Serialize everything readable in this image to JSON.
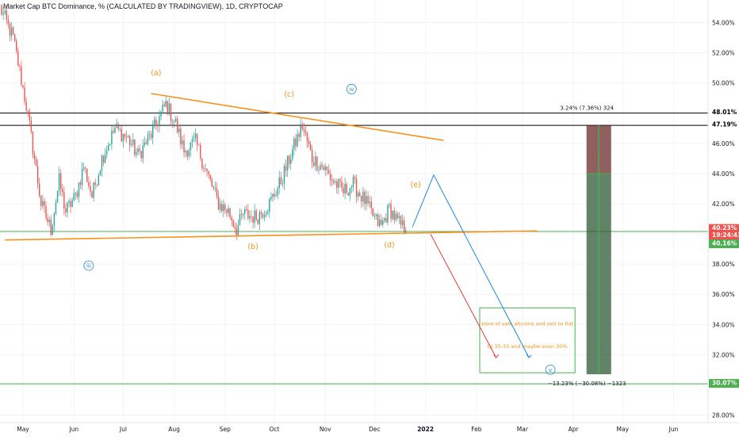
{
  "chart_data": {
    "type": "candlestick",
    "title": "Market Cap BTC Dominance, % (CALCULATED BY TRADINGVIEW), 1D, CRYPTOCAP",
    "y_unit": "%",
    "ylim": [
      27.5,
      55.5
    ],
    "x_start": "2021-04-17",
    "x_end": "2022-06-22",
    "xaxis_ticks": [
      {
        "label": "May",
        "date": "2021-05-01"
      },
      {
        "label": "Jun",
        "date": "2021-06-01"
      },
      {
        "label": "Jul",
        "date": "2021-07-01"
      },
      {
        "label": "Aug",
        "date": "2021-08-01"
      },
      {
        "label": "Sep",
        "date": "2021-09-01"
      },
      {
        "label": "Oct",
        "date": "2021-10-01"
      },
      {
        "label": "Nov",
        "date": "2021-11-01"
      },
      {
        "label": "Dec",
        "date": "2021-12-01"
      },
      {
        "label": "2022",
        "date": "2022-01-01"
      },
      {
        "label": "Feb",
        "date": "2022-02-01"
      },
      {
        "label": "Mar",
        "date": "2022-03-01"
      },
      {
        "label": "Apr",
        "date": "2022-04-01"
      },
      {
        "label": "May",
        "date": "2022-05-01"
      },
      {
        "label": "Jun",
        "date": "2022-06-01"
      }
    ],
    "yaxis_ticks": [
      "28.00%",
      "30.00%",
      "32.00%",
      "34.00%",
      "36.00%",
      "38.00%",
      "40.00%",
      "42.00%",
      "44.00%",
      "46.00%",
      "48.00%",
      "50.00%",
      "52.00%",
      "54.00%"
    ],
    "close_anchors": [
      {
        "date": "2021-04-17",
        "value": 55.0
      },
      {
        "date": "2021-04-25",
        "value": 53.0
      },
      {
        "date": "2021-05-03",
        "value": 48.5
      },
      {
        "date": "2021-05-08",
        "value": 45.0
      },
      {
        "date": "2021-05-12",
        "value": 42.0
      },
      {
        "date": "2021-05-18",
        "value": 40.3
      },
      {
        "date": "2021-05-23",
        "value": 43.5
      },
      {
        "date": "2021-05-27",
        "value": 41.5
      },
      {
        "date": "2021-06-02",
        "value": 42.5
      },
      {
        "date": "2021-06-07",
        "value": 44.5
      },
      {
        "date": "2021-06-12",
        "value": 42.5
      },
      {
        "date": "2021-06-18",
        "value": 45.0
      },
      {
        "date": "2021-06-26",
        "value": 47.0
      },
      {
        "date": "2021-07-04",
        "value": 46.3
      },
      {
        "date": "2021-07-10",
        "value": 45.2
      },
      {
        "date": "2021-07-18",
        "value": 46.6
      },
      {
        "date": "2021-07-27",
        "value": 48.6
      },
      {
        "date": "2021-08-02",
        "value": 47.3
      },
      {
        "date": "2021-08-07",
        "value": 45.5
      },
      {
        "date": "2021-08-14",
        "value": 46.1
      },
      {
        "date": "2021-08-20",
        "value": 44.3
      },
      {
        "date": "2021-08-28",
        "value": 42.0
      },
      {
        "date": "2021-09-03",
        "value": 41.5
      },
      {
        "date": "2021-09-08",
        "value": 40.3
      },
      {
        "date": "2021-09-12",
        "value": 41.3
      },
      {
        "date": "2021-09-20",
        "value": 41.1
      },
      {
        "date": "2021-09-28",
        "value": 42.0
      },
      {
        "date": "2021-10-05",
        "value": 43.5
      },
      {
        "date": "2021-10-13",
        "value": 45.8
      },
      {
        "date": "2021-10-18",
        "value": 47.2
      },
      {
        "date": "2021-10-24",
        "value": 45.0
      },
      {
        "date": "2021-10-31",
        "value": 44.4
      },
      {
        "date": "2021-11-05",
        "value": 43.6
      },
      {
        "date": "2021-11-12",
        "value": 42.8
      },
      {
        "date": "2021-11-18",
        "value": 43.3
      },
      {
        "date": "2021-11-25",
        "value": 42.2
      },
      {
        "date": "2021-12-01",
        "value": 41.0
      },
      {
        "date": "2021-12-05",
        "value": 40.5
      },
      {
        "date": "2021-12-10",
        "value": 41.7
      },
      {
        "date": "2021-12-15",
        "value": 40.8
      },
      {
        "date": "2021-12-20",
        "value": 40.23
      }
    ],
    "last_price": "40.23%",
    "countdown": "19:24:43",
    "price_label_green": "40.16%",
    "horizontal_levels": [
      {
        "value": 48.01,
        "label": "48.01%",
        "color": "#000000"
      },
      {
        "value": 47.19,
        "label": "47.19%",
        "color": "#000000"
      },
      {
        "value": 40.16,
        "label": "40.16%",
        "color": "#4caf50"
      },
      {
        "value": 30.07,
        "label": "30.07%",
        "color": "#4caf50"
      }
    ],
    "trendlines": [
      {
        "name": "upper-trendline",
        "from": {
          "date": "2021-07-18",
          "value": 49.3
        },
        "to": {
          "date": "2022-01-12",
          "value": 46.2
        },
        "color": "#f7931a"
      },
      {
        "name": "lower-trendline",
        "from": {
          "date": "2021-04-20",
          "value": 39.6
        },
        "to": {
          "date": "2022-03-10",
          "value": 40.2
        },
        "color": "#f7931a"
      }
    ],
    "wave_labels": [
      {
        "text": "(a)",
        "date": "2021-07-21",
        "value": 50.5,
        "color": "#f7931a"
      },
      {
        "text": "(b)",
        "date": "2021-09-18",
        "value": 39.0,
        "color": "#f7931a"
      },
      {
        "text": "(c)",
        "date": "2021-10-10",
        "value": 49.1,
        "color": "#f7931a"
      },
      {
        "text": "(d)",
        "date": "2021-12-10",
        "value": 39.1,
        "color": "#f7931a"
      },
      {
        "text": "(e)",
        "date": "2021-12-26",
        "value": 43.1,
        "color": "#f7931a"
      }
    ],
    "circle_labels": [
      {
        "text": "iii",
        "date": "2021-06-10",
        "value": 37.9,
        "color": "#1e88e5"
      },
      {
        "text": "iv",
        "date": "2021-11-17",
        "value": 49.6,
        "color": "#1e88e5"
      },
      {
        "text": "v",
        "date": "2022-03-18",
        "value": 31.0,
        "color": "#1e88e5"
      }
    ],
    "projection_path": {
      "points": [
        {
          "date": "2021-12-24",
          "value": 40.45
        },
        {
          "date": "2022-01-06",
          "value": 43.9
        },
        {
          "date": "2022-03-05",
          "value": 31.8
        }
      ],
      "color": "#1e88e5"
    },
    "red_arrow": {
      "from": {
        "date": "2022-01-04",
        "value": 40.0
      },
      "to": {
        "date": "2022-02-13",
        "value": 31.8
      },
      "color": "#e53935"
    },
    "zone_box": {
      "from_date": "2022-02-03",
      "to_date": "2022-04-02",
      "top": 35.1,
      "bottom": 30.8,
      "text_line1": "zone of sale altcoins and exit to fiat",
      "text_line2": "tp 35-33 and maybe even 30%",
      "text_color": "#f7931a",
      "border_color": "#4caf50"
    },
    "range_tool": {
      "from_date": "2022-04-09",
      "to_date": "2022-04-24",
      "top": 47.19,
      "mid": 43.99,
      "bottom": 30.7,
      "label_top": "3.24% (7.36%) 324",
      "label_bottom": "−13.23% (−30.08%) −1323",
      "red": "#e53935",
      "green": "#4caf50"
    }
  },
  "colors": {
    "up": "#26a69a",
    "down": "#ef5350",
    "grid": "#f0f3fa",
    "axis_text": "#131722"
  }
}
